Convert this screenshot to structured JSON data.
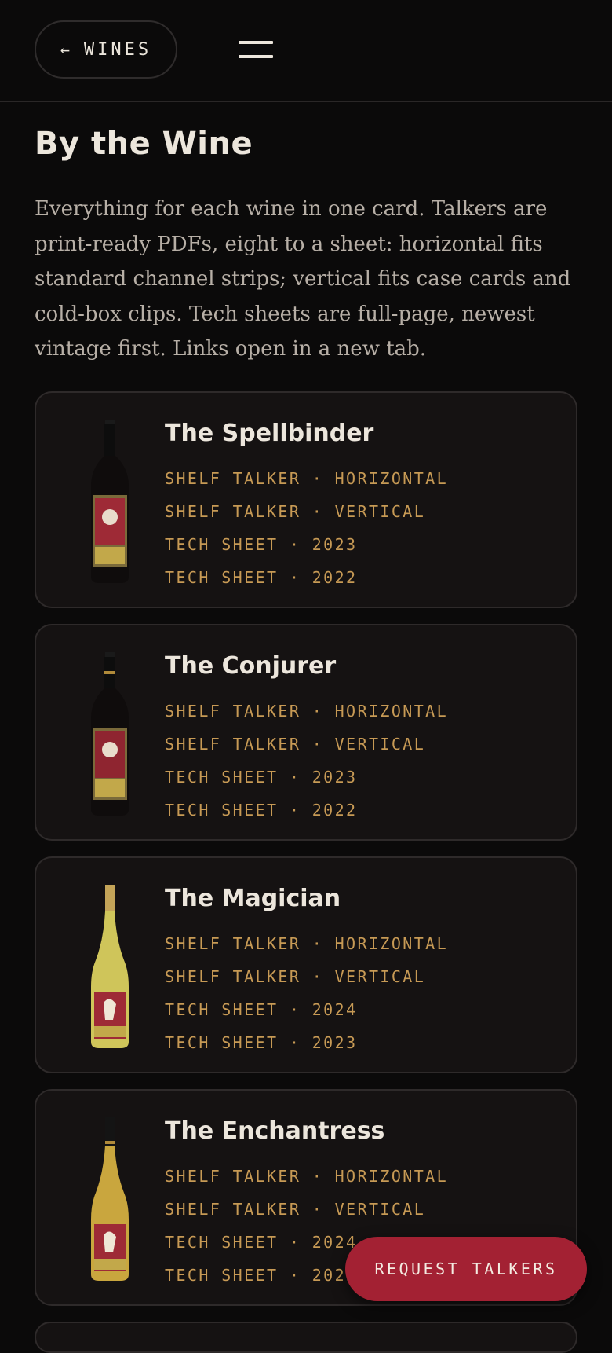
{
  "header": {
    "back_label": "WINES",
    "back_icon": "←",
    "menu_icon": "hamburger-icon"
  },
  "page": {
    "title": "By the Wine",
    "intro": "Everything for each wine in one card. Talkers are print-ready PDFs, eight to a sheet: horizontal fits standard channel strips; vertical fits case cards and cold-box clips. Tech sheets are full-page, newest vintage first. Links open in a new tab."
  },
  "wines": [
    {
      "name": "The Spellbinder",
      "bottle": "red",
      "links": [
        "SHELF TALKER · HORIZONTAL",
        "SHELF TALKER · VERTICAL",
        "TECH SHEET · 2023",
        "TECH SHEET · 2022"
      ]
    },
    {
      "name": "The Conjurer",
      "bottle": "red",
      "links": [
        "SHELF TALKER · HORIZONTAL",
        "SHELF TALKER · VERTICAL",
        "TECH SHEET · 2023",
        "TECH SHEET · 2022"
      ]
    },
    {
      "name": "The Magician",
      "bottle": "white",
      "links": [
        "SHELF TALKER · HORIZONTAL",
        "SHELF TALKER · VERTICAL",
        "TECH SHEET · 2024",
        "TECH SHEET · 2023"
      ]
    },
    {
      "name": "The Enchantress",
      "bottle": "golden",
      "links": [
        "SHELF TALKER · HORIZONTAL",
        "SHELF TALKER · VERTICAL",
        "TECH SHEET · 2024",
        "TECH SHEET · 2023"
      ]
    }
  ],
  "cta": {
    "label": "REQUEST TALKERS"
  },
  "colors": {
    "background": "#0b0a0a",
    "card": "#151212",
    "link": "#c79a55",
    "accent": "#a32133"
  }
}
